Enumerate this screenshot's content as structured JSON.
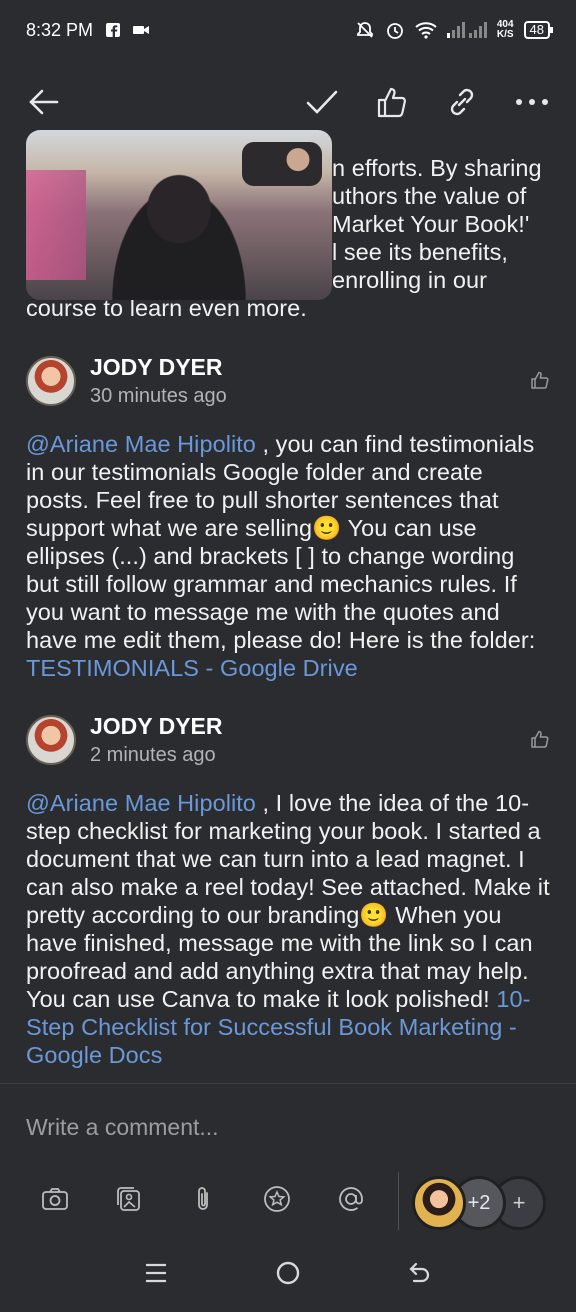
{
  "status_bar": {
    "time": "8:32 PM",
    "speed_value": "404",
    "speed_unit": "K/S",
    "battery": "48",
    "icons": [
      "facebook-icon",
      "video-icon",
      "mute-icon",
      "alarm-icon",
      "wifi-icon",
      "signal-icon"
    ]
  },
  "toolbar": {
    "icons": [
      "back-arrow-icon",
      "check-icon",
      "thumbs-up-icon",
      "link-icon",
      "more-icon"
    ]
  },
  "previous_comment": {
    "lines": [
      "n efforts. By sharing",
      "uthors the value of",
      "Market Your Book!'",
      "l see its benefits,",
      "enrolling in our",
      "course to learn even more."
    ]
  },
  "comments": [
    {
      "author": "JODY DYER",
      "time": "30 minutes ago",
      "mention": "@Ariane Mae Hipolito",
      "body": " , you can find testimonials in our testimonials Google folder and create posts. Feel free to pull shorter sentences that support what we are selling🙂 You can use ellipses (...) and brackets [ ] to change wording but still follow grammar and mechanics rules. If you want to message me with the quotes and have me edit them, please do! Here is the folder: ",
      "link": "TESTIMONIALS - Google Drive"
    },
    {
      "author": "JODY DYER",
      "time": "2 minutes ago",
      "mention": "@Ariane Mae Hipolito",
      "body": " , I love the idea of the 10-step checklist for marketing your book. I started a document that we can turn into a lead magnet. I can also make a reel today! See attached. Make it pretty according to our branding🙂 When you have finished, message me with the link so I can proofread and add anything extra that may help. You can use Canva to make it look polished! ",
      "link": "10-Step Checklist for Successful Book Marketing - Google Docs"
    }
  ],
  "composer": {
    "placeholder": "Write a comment...",
    "icons": [
      "camera-icon",
      "gallery-icon",
      "paperclip-icon",
      "star-icon",
      "at-sign-icon"
    ],
    "participants_more": "+2",
    "add_label": "+"
  },
  "nav_bar": {
    "menu": "☰",
    "home": "○",
    "back": "↩"
  },
  "colors": {
    "background": "#2b2c30",
    "link": "#6a98d8",
    "text": "#f1f1f1",
    "muted": "#b3b3b3"
  }
}
